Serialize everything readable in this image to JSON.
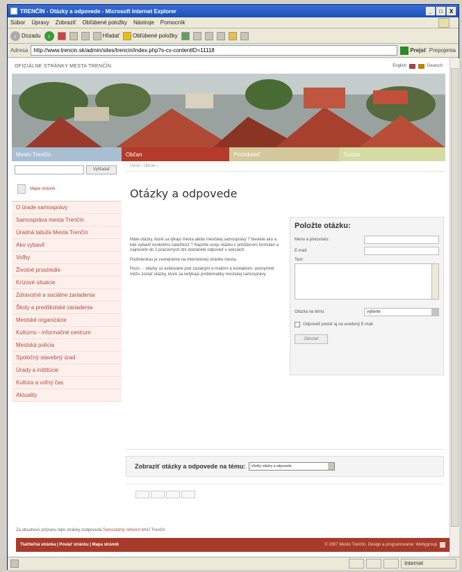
{
  "window": {
    "title": "TRENČÍN - Otázky a odpovede - Microsoft Internet Explorer",
    "controls": [
      "_",
      "□",
      "X"
    ]
  },
  "menubar": [
    "Súbor",
    "Úpravy",
    "Zobraziť",
    "Obľúbené položky",
    "Nástroje",
    "Pomocník"
  ],
  "toolbar": {
    "back": "Dozadu",
    "search": "Hľadať",
    "favorites": "Obľúbené položky"
  },
  "address": {
    "label": "Adresa",
    "url": "http://www.trencin.sk/admin/sites/trencin/index.php?s-cv-contentID=11118",
    "go": "Prejsť",
    "links": "Prepojenia"
  },
  "page": {
    "official": "OFICIÁLNE STRÁNKY MESTA TRENČÍN",
    "langs": [
      "English",
      "Deutsch"
    ],
    "nav": [
      "Mesto Trenčín",
      "Občan",
      "Podnikateľ",
      "Turista"
    ],
    "search_button": "Vyhľadať",
    "sitemap": "Mapa stránok",
    "menu": [
      "O úrade samosprávy",
      "Samospráva mesta Trenčín",
      "Úradná tabuľa Mesta Trenčín",
      "Ako vybaviť",
      "Voľby",
      "Životné prostredie",
      "Krízové situácie",
      "Zdravotné a sociálne zariadenia",
      "Školy a predškolské zariadenia",
      "Mestské organizácie",
      "Kultúrno - informačné centrum",
      "Mestská polícia",
      "Spoločný stavebný úrad",
      "Úrady a inštitúcie",
      "Kultúra a voľný čas",
      "Aktuality"
    ],
    "breadcrumb": "Úvod › Občan ›",
    "title": "Otázky a odpovede",
    "intro_p1": "Máte otázky, ktoré sa týkajú mesta alebo mestskej samosprávy ? Neviete ako a kde vybaviť konkrétnu záležitosť ? Napíšte svoju otázku v priloženom formulári a najneskôr do 2 pracovných dní dostanete odpoveď v sekciách.",
    "intro_p2": "Podmienkou je zverejnenie na internetovej stránke mesta.",
    "intro_p3": "Pozn.: - otázky sú evidované pod zaslaným e-mailom a kontaktom, anonymné môžu zostať otázky, ktoré sa netýkajú problematiky mestskej samosprávy.",
    "form": {
      "heading": "Položte otázku:",
      "name_label": "Meno a priezvisko:",
      "email_label": "E-mail:",
      "text_label": "Text:",
      "topic_label": "Otázka na tému:",
      "topic_value": "vyberte",
      "checkbox_label": "Odpoveď poslať aj na uvedený E-mail",
      "submit": "Odoslať"
    },
    "topic_bar": {
      "label": "Zobraziť otázky a odpovede na tému:",
      "select_value": "Všetky otázky a odpovede"
    },
    "footer_note_prefix": "Za obsahovú prípravu tejto stránky zodpovedá",
    "footer_note_link": "Samostatný referent",
    "footer_note_suffix": "MsÚ Trenčín",
    "footer_left": "Tlačiteľná stránka  |  Poslať stránku  |  Mapa stránok",
    "footer_right": "© 2007 Mesto Trenčín. Design a programovanie: Webygroup"
  },
  "statusbar": {
    "zone": "Internet"
  },
  "colors": {
    "nav_blue": "#a8bed2",
    "nav_red": "#b53a2a",
    "nav_tan": "#d2c89a",
    "nav_lime": "#d4dca4",
    "link_red": "#b34a3a"
  }
}
